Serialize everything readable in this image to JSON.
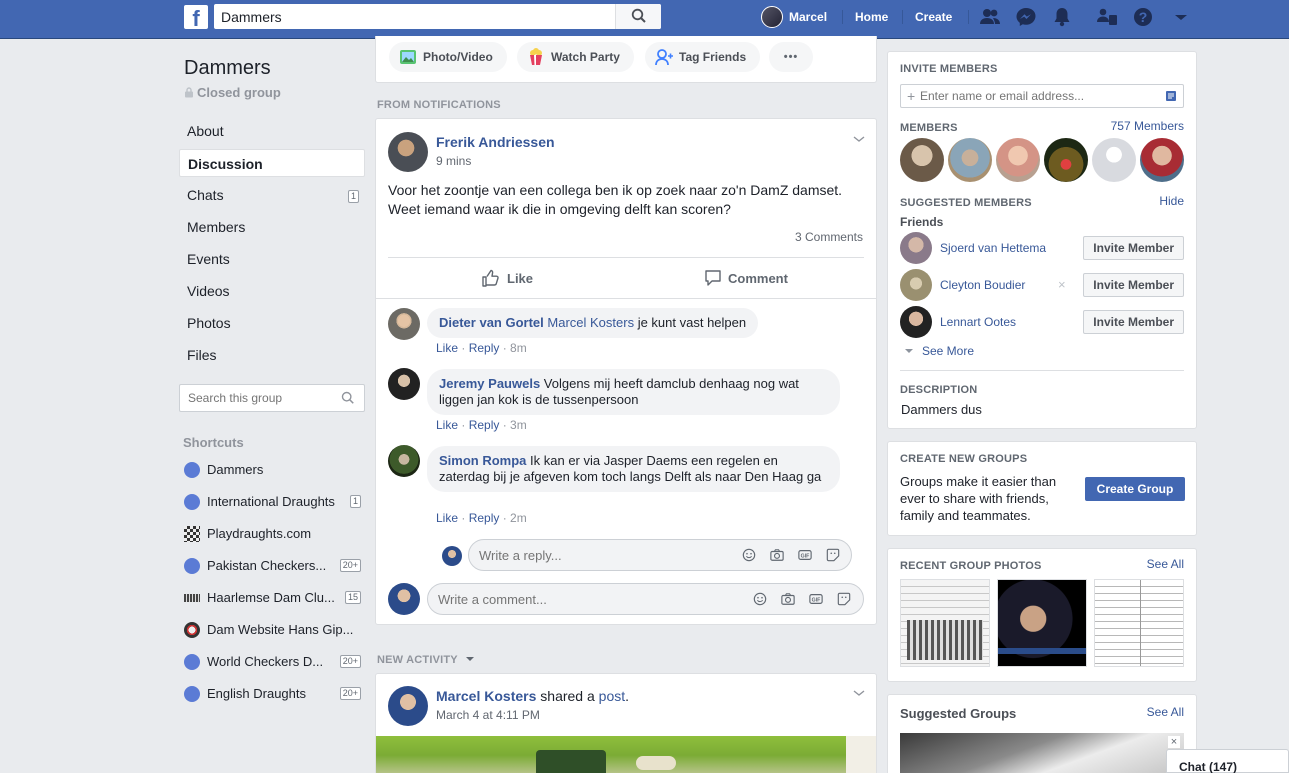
{
  "topbar": {
    "logo": "f",
    "search_value": "Dammers",
    "profile_name": "Marcel",
    "home": "Home",
    "create": "Create",
    "icons": [
      "friends-icon",
      "messenger-icon",
      "notifications-icon",
      "groups-icon",
      "help-icon",
      "dropdown-icon"
    ]
  },
  "left": {
    "group_name": "Dammers",
    "privacy": "Closed group",
    "nav": [
      {
        "label": "About",
        "count": ""
      },
      {
        "label": "Discussion",
        "count": "",
        "active": true
      },
      {
        "label": "Chats",
        "count": "1"
      },
      {
        "label": "Members",
        "count": ""
      },
      {
        "label": "Events",
        "count": ""
      },
      {
        "label": "Videos",
        "count": ""
      },
      {
        "label": "Photos",
        "count": ""
      },
      {
        "label": "Files",
        "count": ""
      }
    ],
    "search_placeholder": "Search this group",
    "shortcuts_title": "Shortcuts",
    "shortcuts": [
      {
        "label": "Dammers",
        "count": ""
      },
      {
        "label": "International Draughts",
        "count": "1"
      },
      {
        "label": "Playdraughts.com",
        "count": ""
      },
      {
        "label": "Pakistan Checkers...",
        "count": "20+"
      },
      {
        "label": "Haarlemse Dam Clu...",
        "count": "15"
      },
      {
        "label": "Dam Website Hans Gip...",
        "count": ""
      },
      {
        "label": "World Checkers D...",
        "count": "20+"
      },
      {
        "label": "English Draughts",
        "count": "20+"
      }
    ]
  },
  "composer": {
    "photo_video": "Photo/Video",
    "watch_party": "Watch Party",
    "tag_friends": "Tag Friends",
    "more": "•••"
  },
  "feed": {
    "from_notifications": "FROM NOTIFICATIONS",
    "post": {
      "author": "Frerik Andriessen",
      "time": "9 mins",
      "text": "Voor het zoontje van een collega ben ik op zoek naar zo'n DamZ damset. Weet iemand waar ik die in omgeving delft kan scoren?",
      "comments_count": "3 Comments",
      "like": "Like",
      "comment": "Comment"
    },
    "comments": [
      {
        "author": "Dieter van Gortel",
        "mention": "Marcel Kosters",
        "text": " je kunt vast helpen",
        "like": "Like",
        "reply": "Reply",
        "time": "8m"
      },
      {
        "author": "Jeremy Pauwels",
        "mention": "",
        "text": " Volgens mij heeft damclub denhaag nog wat liggen jan kok is de tussenpersoon",
        "like": "Like",
        "reply": "Reply",
        "time": "3m"
      },
      {
        "author": "Simon Rompa",
        "mention": "",
        "text": " Ik kan er via Jasper Daems een regelen en zaterdag bij je afgeven kom toch langs Delft als naar Den Haag ga",
        "like": "Like",
        "reply": "Reply",
        "time": "2m"
      }
    ],
    "reply_placeholder": "Write a reply...",
    "comment_placeholder": "Write a comment...",
    "new_activity": "NEW ACTIVITY",
    "post2": {
      "author": "Marcel Kosters",
      "shared": " shared a ",
      "post_link": "post",
      "period": ".",
      "time": "March 4 at 4:11 PM"
    }
  },
  "right": {
    "invite_title": "INVITE MEMBERS",
    "invite_placeholder": "Enter name or email address...",
    "members_title": "MEMBERS",
    "members_count": "757 Members",
    "suggested_title": "SUGGESTED MEMBERS",
    "hide": "Hide",
    "friends": "Friends",
    "suggested": [
      {
        "name": "Sjoerd van Hettema",
        "button": "Invite Member"
      },
      {
        "name": "Cleyton Boudier",
        "button": "Invite Member"
      },
      {
        "name": "Lennart Ootes",
        "button": "Invite Member"
      }
    ],
    "see_more": "See More",
    "description_title": "DESCRIPTION",
    "description": "Dammers dus",
    "create_groups_title": "CREATE NEW GROUPS",
    "create_groups_text": "Groups make it easier than ever to share with friends, family and teammates.",
    "create_group_btn": "Create Group",
    "recent_photos_title": "RECENT GROUP PHOTOS",
    "see_all": "See All",
    "suggested_groups_title": "Suggested Groups",
    "see_all_2": "See All",
    "chat": "Chat (147)"
  },
  "colors": {
    "brand": "#4267b2",
    "link": "#385898",
    "background": "#e9ebee"
  }
}
